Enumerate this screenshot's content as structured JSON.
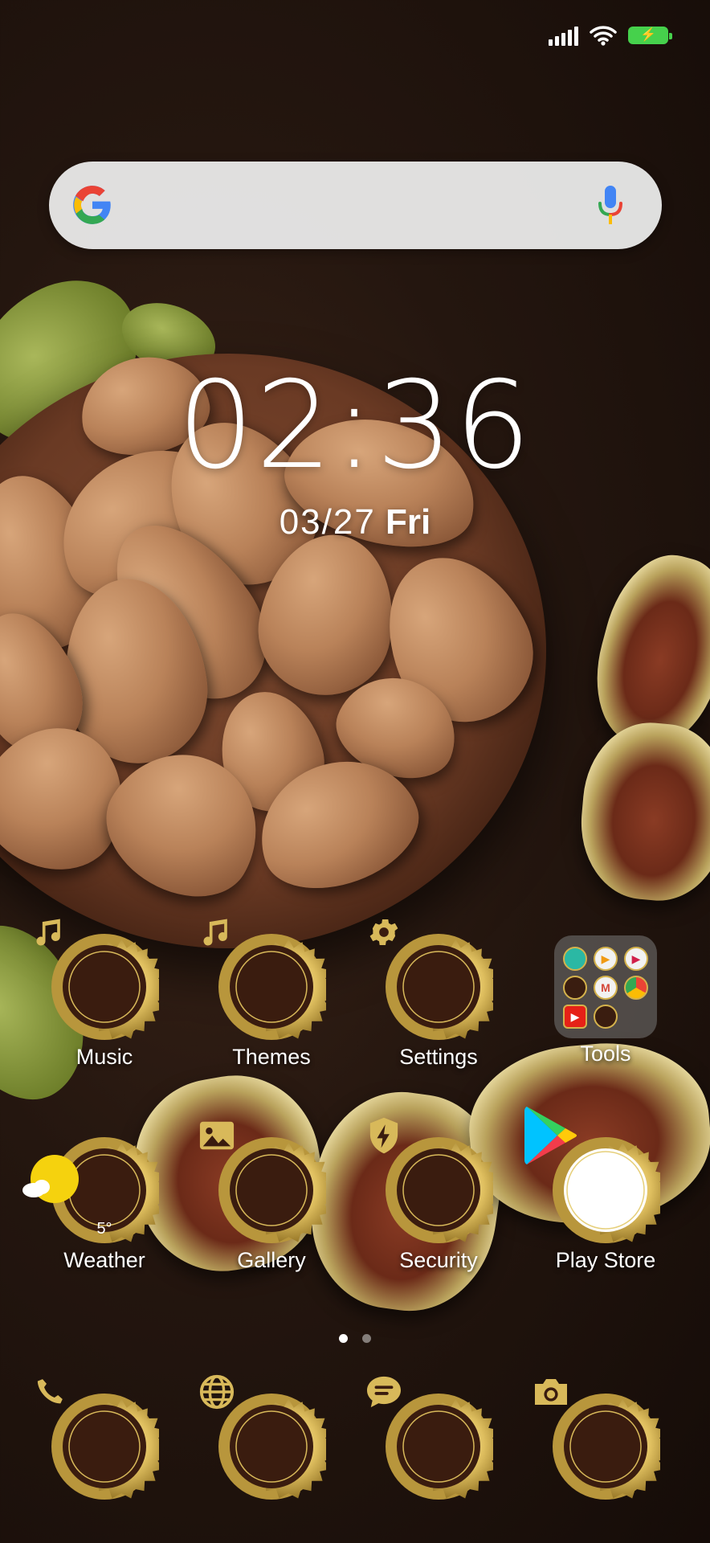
{
  "status_bar": {
    "signal_icon": "cellular-signal-icon",
    "wifi_icon": "wifi-icon",
    "battery_icon": "battery-charging-icon"
  },
  "search_bar": {
    "logo_icon": "google-g-icon",
    "mic_icon": "microphone-icon"
  },
  "clock": {
    "time": "02:36",
    "date": "03/27",
    "weekday": "Fri"
  },
  "apps_row1": [
    {
      "label": "Music",
      "icon": "music-note-icon"
    },
    {
      "label": "Themes",
      "icon": "music-note-icon"
    },
    {
      "label": "Settings",
      "icon": "gear-icon"
    },
    {
      "label": "Tools",
      "icon": "folder-icon"
    }
  ],
  "apps_row2": [
    {
      "label": "Weather",
      "icon": "sun-cloud-icon",
      "temp": "5°"
    },
    {
      "label": "Gallery",
      "icon": "image-icon"
    },
    {
      "label": "Security",
      "icon": "shield-bolt-icon"
    },
    {
      "label": "Play Store",
      "icon": "play-store-icon"
    }
  ],
  "dock": [
    {
      "icon": "phone-icon"
    },
    {
      "icon": "globe-icon"
    },
    {
      "icon": "message-icon"
    },
    {
      "icon": "camera-icon"
    }
  ],
  "page_indicator": {
    "pages": 2,
    "active": 0
  },
  "colors": {
    "gold": "#d8b95a",
    "badge_bg": "#3a1c0f",
    "battery_green": "#46d14c",
    "search_bg": "#ececec"
  }
}
